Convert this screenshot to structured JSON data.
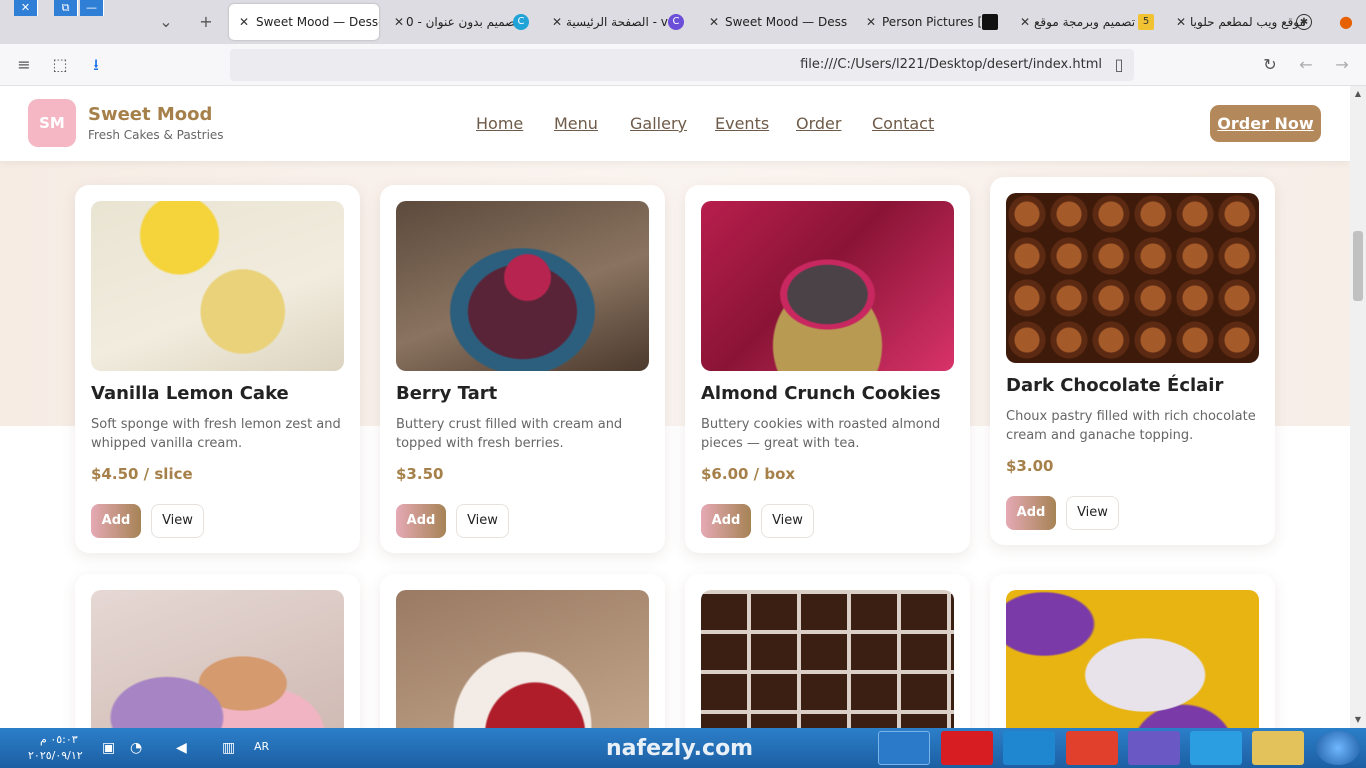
{
  "browser": {
    "window_controls": {
      "close": "✕",
      "restore": "⧉",
      "minimize": "—"
    },
    "tabs": [
      {
        "label": "Sweet Mood — Desse",
        "active": true,
        "icon": "close-icon"
      },
      {
        "label": "تصميم بدون عنوان - 0",
        "icon": "canva-icon"
      },
      {
        "label": "الصفحة الرئيسية - va",
        "icon": "canva-icon"
      },
      {
        "label": "Sweet Mood — Desse",
        "icon": "close-icon"
      },
      {
        "label": "Person Pictures [",
        "icon": "unsplash-icon"
      },
      {
        "label": "تصميم وبرمجة موقع",
        "badge": "5",
        "icon": "mostaql-icon"
      },
      {
        "label": "موقع ويب لمطعم حلويا",
        "icon": "chatgpt-icon"
      }
    ],
    "url": "file:///C:/Users/l221/Desktop/desert/index.html"
  },
  "site": {
    "logo_initials": "SM",
    "brand_name": "Sweet Mood",
    "brand_tagline": "Fresh Cakes & Pastries",
    "nav": [
      "Home",
      "Menu",
      "Gallery",
      "Events",
      "Order",
      "Contact"
    ],
    "cta": "Order Now",
    "accent_color": "#a6804a",
    "products": [
      {
        "title": "Vanilla Lemon Cake",
        "description": "Soft sponge with fresh lemon zest and whipped vanilla cream.",
        "price": "$4.50 / slice",
        "add": "Add",
        "view": "View"
      },
      {
        "title": "Berry Tart",
        "description": "Buttery crust filled with cream and topped with fresh berries.",
        "price": "$3.50",
        "add": "Add",
        "view": "View"
      },
      {
        "title": "Almond Crunch Cookies",
        "description": "Buttery cookies with roasted almond pieces — great with tea.",
        "price": "$6.00 / box",
        "add": "Add",
        "view": "View"
      },
      {
        "title": "Dark Chocolate Éclair",
        "description": "Choux pastry filled with rich chocolate cream and ganache topping.",
        "price": "$3.00",
        "add": "Add",
        "view": "View"
      }
    ]
  },
  "taskbar": {
    "time": "٠٥:٠٣ م",
    "date": "٢٠٢٥/٠٩/١٢",
    "language": "AR",
    "watermark": "nafezly.com"
  }
}
